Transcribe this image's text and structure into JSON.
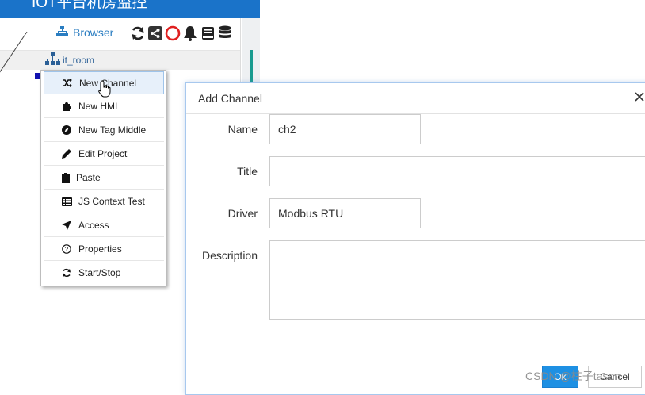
{
  "app": {
    "title": "IOT平台机房监控"
  },
  "browser_tab": {
    "label": "Browser"
  },
  "toolbar": {
    "icons": [
      "refresh-icon",
      "share-icon",
      "stop-circle-icon",
      "bell-icon",
      "book-icon",
      "database-icon"
    ]
  },
  "tree": {
    "node_label": "it_room"
  },
  "context_menu": {
    "items": [
      {
        "label": "New Channel",
        "icon": "shuffle-icon"
      },
      {
        "label": "New HMI",
        "icon": "puzzle-icon"
      },
      {
        "label": "New Tag Middle",
        "icon": "compass-icon"
      },
      {
        "label": "Edit Project",
        "icon": "pencil-icon"
      },
      {
        "label": "Paste",
        "icon": "clipboard-icon"
      },
      {
        "label": "JS Context Test",
        "icon": "list-icon"
      },
      {
        "label": "Access",
        "icon": "send-icon"
      },
      {
        "label": "Properties",
        "icon": "question-circle-icon"
      },
      {
        "label": "Start/Stop",
        "icon": "refresh-icon"
      }
    ]
  },
  "dialog": {
    "title": "Add Channel",
    "fields": {
      "name": {
        "label": "Name",
        "value": "ch2"
      },
      "title": {
        "label": "Title",
        "value": ""
      },
      "driver": {
        "label": "Driver",
        "value": "Modbus RTU"
      },
      "description": {
        "label": "Description",
        "value": ""
      }
    },
    "ok_label": "Ok",
    "cancel_label": "Cancel"
  },
  "watermark": "CSDN @柱子tason"
}
